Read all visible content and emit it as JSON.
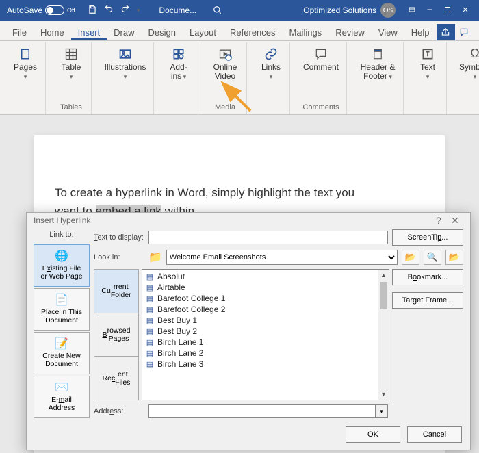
{
  "titlebar": {
    "autosave_label": "AutoSave",
    "autosave_value": "Off",
    "doc_title": "Docume...",
    "user_name": "Optimized Solutions",
    "user_initials": "OS"
  },
  "tabs": {
    "items": [
      "File",
      "Home",
      "Insert",
      "Draw",
      "Design",
      "Layout",
      "References",
      "Mailings",
      "Review",
      "View",
      "Help"
    ],
    "active_index": 2
  },
  "ribbon": {
    "groups": [
      {
        "label": "",
        "items": [
          {
            "label": "Pages",
            "dropdown": true
          }
        ]
      },
      {
        "label": "Tables",
        "items": [
          {
            "label": "Table",
            "dropdown": true
          }
        ]
      },
      {
        "label": "",
        "items": [
          {
            "label": "Illustrations",
            "dropdown": true
          }
        ]
      },
      {
        "label": "",
        "items": [
          {
            "label": "Add-ins",
            "dropdown": true
          }
        ]
      },
      {
        "label": "Media",
        "items": [
          {
            "label": "Online Video"
          }
        ]
      },
      {
        "label": "",
        "items": [
          {
            "label": "Links",
            "dropdown": true
          }
        ]
      },
      {
        "label": "Comments",
        "items": [
          {
            "label": "Comment"
          }
        ]
      },
      {
        "label": "",
        "items": [
          {
            "label": "Header & Footer",
            "dropdown": true
          }
        ]
      },
      {
        "label": "",
        "items": [
          {
            "label": "Text",
            "dropdown": true
          }
        ]
      },
      {
        "label": "",
        "items": [
          {
            "label": "Symbols",
            "dropdown": true
          }
        ]
      }
    ]
  },
  "document": {
    "line1": "To create a hyperlink in Word, simply highlight the text you",
    "line2_pre": "want to ",
    "line2_hl": "embed a link",
    "line2_post": " within."
  },
  "dialog": {
    "title": "Insert Hyperlink",
    "link_to_label": "Link to:",
    "linkto_options": [
      {
        "label_line1": "Existing File",
        "label_line2": "or Web Page",
        "mnemonic": "x",
        "selected": true
      },
      {
        "label_line1": "Place in This",
        "label_line2": "Document",
        "mnemonic": "A"
      },
      {
        "label_line1": "Create New",
        "label_line2": "Document",
        "mnemonic": "N"
      },
      {
        "label_line1": "E-mail",
        "label_line2": "Address",
        "mnemonic": "m"
      }
    ],
    "text_to_display_label": "Text to display:",
    "text_to_display_value": "",
    "look_in_label": "Look in:",
    "look_in_value": "Welcome Email Screenshots",
    "folder_tabs": [
      {
        "l1": "Current",
        "l2": "Folder",
        "mnemonic": "u",
        "selected": true
      },
      {
        "l1": "Browsed",
        "l2": "Pages",
        "mnemonic": "B"
      },
      {
        "l1": "Recent",
        "l2": "Files",
        "mnemonic": "c"
      }
    ],
    "files": [
      "Absolut",
      "Airtable",
      "Barefoot College 1",
      "Barefoot College 2",
      "Best Buy 1",
      "Best Buy 2",
      "Birch Lane 1",
      "Birch Lane 2",
      "Birch Lane 3"
    ],
    "address_label": "Address:",
    "address_value": "",
    "side_buttons": {
      "screentip": "ScreenTip...",
      "bookmark": "Bookmark...",
      "target_frame": "Target Frame..."
    },
    "footer": {
      "ok": "OK",
      "cancel": "Cancel"
    }
  }
}
